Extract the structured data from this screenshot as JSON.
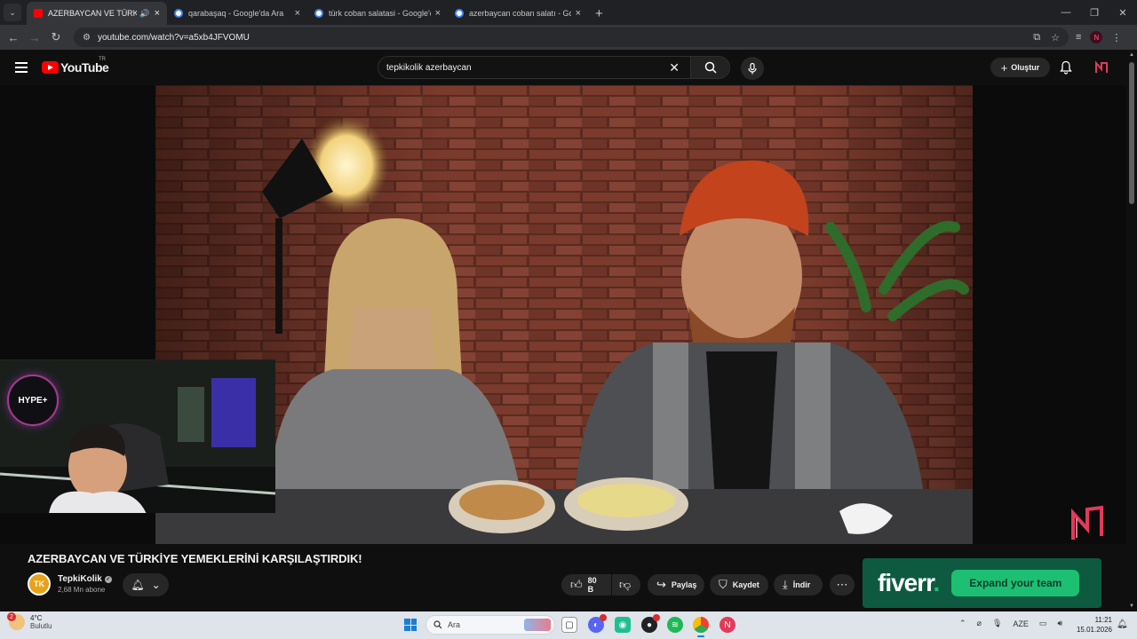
{
  "browser": {
    "tabs": [
      {
        "title": "AZERBAYCAN VE TÜRKİYE Y",
        "active": true,
        "favicon_color": "#ff0000"
      },
      {
        "title": "qarabaşaq - Google'da Ara",
        "active": false,
        "favicon_color": "#4285f4"
      },
      {
        "title": "türk coban salatasi - Google'da",
        "active": false,
        "favicon_color": "#4285f4"
      },
      {
        "title": "azerbaycan coban salatı - Goog",
        "active": false,
        "favicon_color": "#4285f4"
      }
    ],
    "url": "youtube.com/watch?v=a5xb4JFVOMU"
  },
  "youtube": {
    "logo_text": "YouTube",
    "country_code": "TR",
    "search_value": "tepkikolik azerbaycan",
    "create_label": "Oluştur"
  },
  "video": {
    "title": "AZERBAYCAN VE TÜRKİYE YEMEKLERİNİ KARŞILAŞTIRDIK!",
    "channel_name": "TepkiKolik",
    "channel_initials": "TK",
    "subscribers": "2,68 Mn abone",
    "likes": "80 B",
    "share_label": "Paylaş",
    "save_label": "Kaydet",
    "download_label": "İndir"
  },
  "overlay": {
    "hype_label": "HYPE+"
  },
  "ad": {
    "brand": "fiverr",
    "brand_dot": ".",
    "cta": "Expand your team"
  },
  "taskbar": {
    "weather_temp": "4°C",
    "weather_desc": "Bulutlu",
    "weather_badge": "2",
    "search_label": "Ara",
    "language": "AZE",
    "time": "11:21",
    "date": "15.01.2026"
  },
  "colors": {
    "youtube_red": "#ff0000",
    "fiverr_green": "#1dbf73",
    "ad_background": "#0e5a40"
  }
}
